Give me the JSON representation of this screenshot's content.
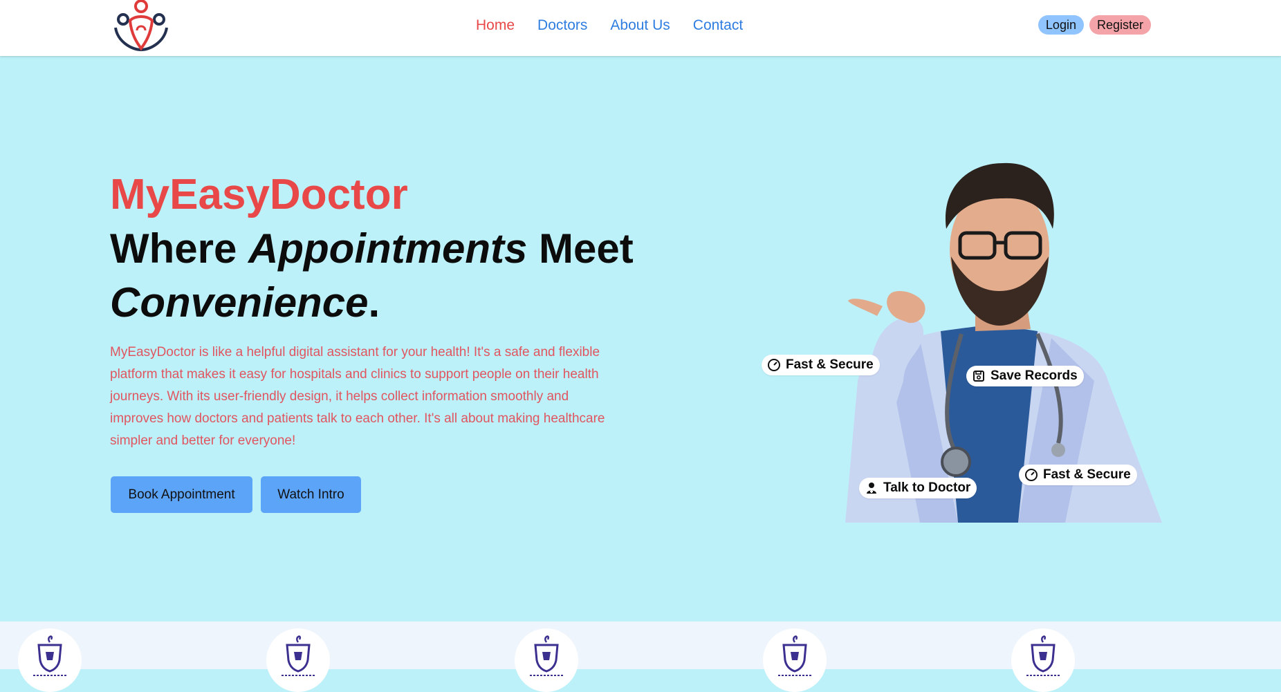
{
  "nav": {
    "links": [
      {
        "label": "Home",
        "active": true
      },
      {
        "label": "Doctors",
        "active": false
      },
      {
        "label": "About Us",
        "active": false
      },
      {
        "label": "Contact",
        "active": false
      }
    ],
    "login_label": "Login",
    "register_label": "Register"
  },
  "hero": {
    "brand": "MyEasyDoctor",
    "headline_part1": "Where ",
    "headline_italic1": "Appointments",
    "headline_part2": " Meet ",
    "headline_italic2": "Convenience",
    "headline_end": ".",
    "description": "MyEasyDoctor is like a helpful digital assistant for your health! It's a safe and flexible platform that makes it easy for hospitals and clinics to support people on their health journeys. With its user-friendly design, it helps collect information smoothly and improves how doctors and patients talk to each other. It's all about making healthcare simpler and better for everyone!",
    "book_label": "Book Appointment",
    "watch_label": "Watch Intro"
  },
  "badges": [
    {
      "label": "Fast & Secure",
      "icon": "speedometer-icon"
    },
    {
      "label": "Save Records",
      "icon": "floppy-disk-icon"
    },
    {
      "label": "Talk to Doctor",
      "icon": "doctor-icon"
    },
    {
      "label": "Fast & Secure",
      "icon": "speedometer-icon"
    }
  ],
  "partners": {
    "count": 5
  },
  "colors": {
    "brand_red": "#e84848",
    "nav_blue": "#2f7de0",
    "hero_bg": "#bdf1f9",
    "button_blue": "#5ba4f8",
    "login_bg": "#90c4ff",
    "register_bg": "#f4a3a8",
    "strip_bg": "#eef5fc"
  }
}
